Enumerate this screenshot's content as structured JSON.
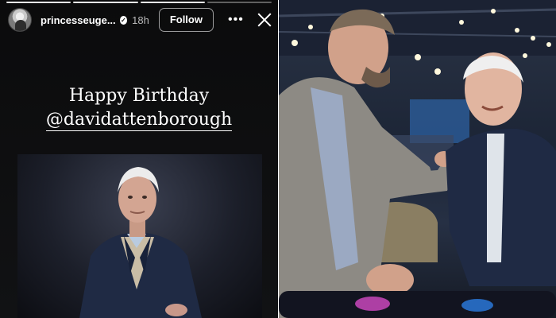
{
  "story": {
    "username": "princesseuge...",
    "verified_icon": "verified-badge-icon",
    "time_ago": "18h",
    "follow_label": "Follow",
    "more_icon": "more-options-icon",
    "close_icon": "close-icon",
    "greeting_line1": "Happy Birthday",
    "greeting_mention": "@davidattenborough"
  },
  "colors": {
    "story_bg": "#0b0b0c",
    "text": "#ffffff",
    "jacket_navy": "#1f2a44",
    "blazer_check": "#8d8a84"
  }
}
